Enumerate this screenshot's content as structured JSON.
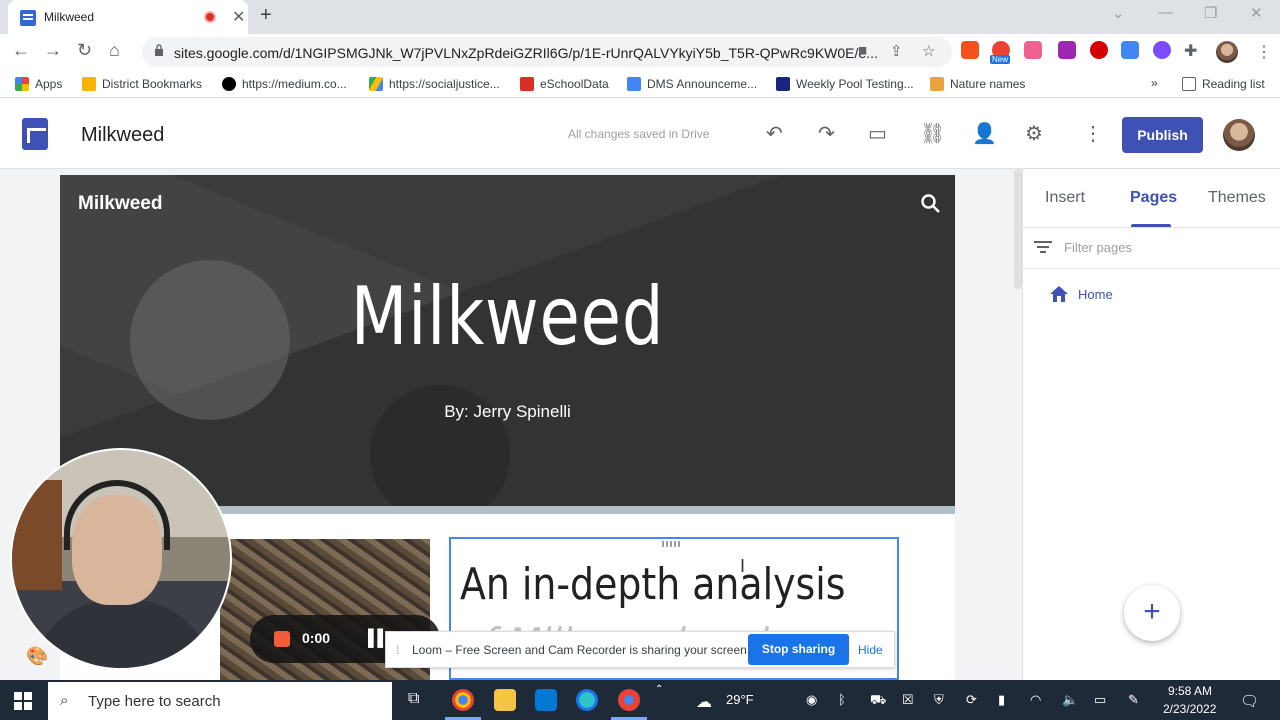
{
  "browser": {
    "tab_title": "Milkweed",
    "url": "sites.google.com/d/1NGIPSMGJNk_W7jPVLNxZpRdeiGZRIl6G/p/1E-rUnrQALVYkyiY5b_T5R-QPwRc9KW0E/e...",
    "new_badge": "New",
    "bookmarks": [
      {
        "label": "Apps",
        "icon": "apps-grid-icon",
        "color": "#ea4335"
      },
      {
        "label": "District Bookmarks",
        "icon": "folder-icon",
        "color": "#f4b400"
      },
      {
        "label": "https://medium.co...",
        "icon": "medium-icon",
        "color": "#000000"
      },
      {
        "label": "https://socialjustice...",
        "icon": "drive-icon",
        "color": "#34a853"
      },
      {
        "label": "eSchoolData",
        "icon": "esd-icon",
        "color": "#d93025"
      },
      {
        "label": "DMS Announceme...",
        "icon": "dms-icon",
        "color": "#4285f4"
      },
      {
        "label": "Weekly Pool Testing...",
        "icon": "forms-icon",
        "color": "#1a237e"
      },
      {
        "label": "Nature names",
        "icon": "bookmark-icon",
        "color": "#e8a33d"
      }
    ],
    "more_bookmarks": "»",
    "reading_list": "Reading list"
  },
  "sites": {
    "site_name": "Milkweed",
    "save_status": "All changes saved in Drive",
    "publish_label": "Publish",
    "brand_color": "#3f51b5"
  },
  "page": {
    "nav_title": "Milkweed",
    "header_title": "Milkweed",
    "header_subtitle": "By: Jerry Spinelli",
    "text_heading_line1": "An in-depth analysis",
    "text_heading_line2": "of Milkweed and"
  },
  "panel": {
    "tabs": [
      "Insert",
      "Pages",
      "Themes"
    ],
    "active_tab": "Pages",
    "filter_placeholder": "Filter pages",
    "pages": [
      {
        "label": "Home",
        "icon": "home-icon"
      }
    ],
    "add_label": "+"
  },
  "loom": {
    "timer": "0:00",
    "share_message": "Loom – Free Screen and Cam Recorder is sharing your screen.",
    "stop_label": "Stop sharing",
    "hide_label": "Hide"
  },
  "taskbar": {
    "search_placeholder": "Type here to search",
    "temperature": "29°F",
    "time": "9:58 AM",
    "date": "2/23/2022"
  }
}
